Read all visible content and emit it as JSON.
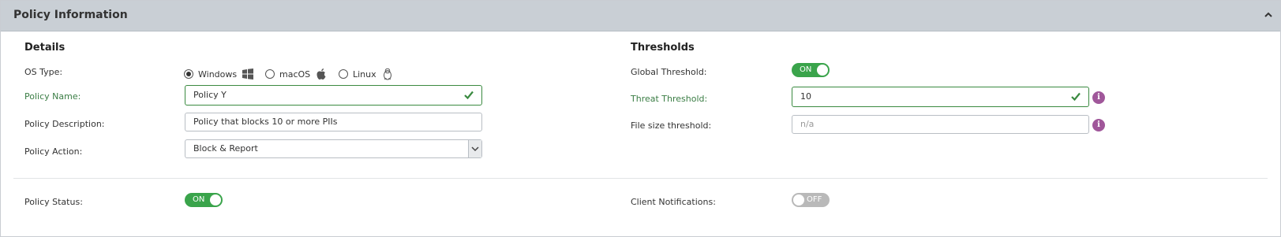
{
  "panel": {
    "title": "Policy Information"
  },
  "details": {
    "title": "Details",
    "os_type_label": "OS Type:",
    "os_options": [
      {
        "label": "Windows",
        "icon": "windows-icon",
        "selected": true
      },
      {
        "label": "macOS",
        "icon": "apple-icon",
        "selected": false
      },
      {
        "label": "Linux",
        "icon": "linux-icon",
        "selected": false
      }
    ],
    "policy_name_label": "Policy Name:",
    "policy_name_value": "Policy Y",
    "policy_description_label": "Policy Description:",
    "policy_description_value": "Policy that blocks 10 or more PIIs",
    "policy_action_label": "Policy Action:",
    "policy_action_value": "Block & Report"
  },
  "thresholds": {
    "title": "Thresholds",
    "global_threshold_label": "Global Threshold:",
    "global_threshold_state": "ON",
    "threat_threshold_label": "Threat Threshold:",
    "threat_threshold_value": "10",
    "file_size_label": "File size threshold:",
    "file_size_placeholder": "n/a"
  },
  "footer": {
    "policy_status_label": "Policy Status:",
    "policy_status_state": "ON",
    "client_notifications_label": "Client Notifications:",
    "client_notifications_state": "OFF"
  },
  "colors": {
    "header_bg": "#c9cfd5",
    "accent_green": "#3aa44b",
    "valid_label_green": "#3a7d44",
    "info_purple": "#a0579a",
    "toggle_off": "#b9b9b9"
  }
}
